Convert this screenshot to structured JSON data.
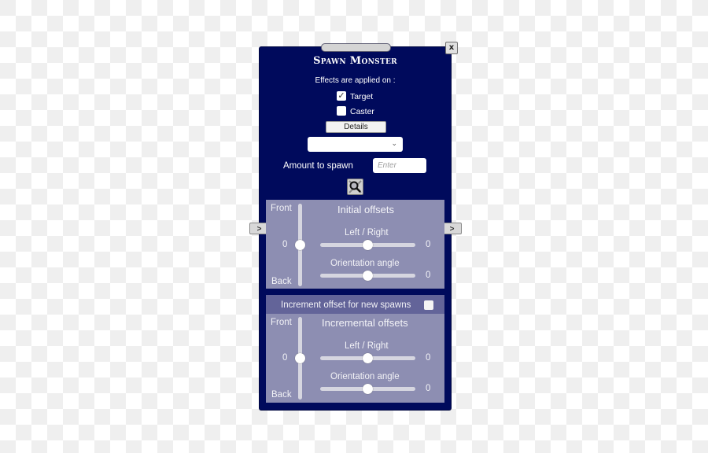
{
  "window": {
    "title": "Spawn Monster",
    "close_label": "x"
  },
  "effects": {
    "label": "Effects are applied on :",
    "target": {
      "label": "Target",
      "checked": true
    },
    "caster": {
      "label": "Caster",
      "checked": false
    },
    "check_glyph": "✓"
  },
  "details_button": "Details",
  "dropdown": {
    "selected": "",
    "chevron": "⌄"
  },
  "amount": {
    "label": "Amount to spawn",
    "placeholder": "Enter",
    "value": ""
  },
  "search_icon": "search-icon",
  "nav": {
    "prev": ">",
    "next": ">"
  },
  "initial": {
    "heading": "Initial offsets",
    "front": "Front",
    "back": "Back",
    "front_back_value": "0",
    "left_right": {
      "label": "Left / Right",
      "value": "0"
    },
    "orientation": {
      "label": "Orientation angle",
      "value": "0"
    },
    "slider_fractions": {
      "front_back": 0.5,
      "left_right": 0.5,
      "orientation": 0.5
    }
  },
  "increment_toggle": {
    "label": "Increment offset for new spawns",
    "checked": false
  },
  "incremental": {
    "heading": "Incremental offsets",
    "front": "Front",
    "back": "Back",
    "front_back_value": "0",
    "left_right": {
      "label": "Left / Right",
      "value": "0"
    },
    "orientation": {
      "label": "Orientation angle",
      "value": "0"
    },
    "slider_fractions": {
      "front_back": 0.5,
      "left_right": 0.5,
      "orientation": 0.5
    }
  },
  "colors": {
    "panel_bg": "#000a5c",
    "subpanel_bg": "#8d8eb2",
    "strip_bg": "#636499"
  }
}
